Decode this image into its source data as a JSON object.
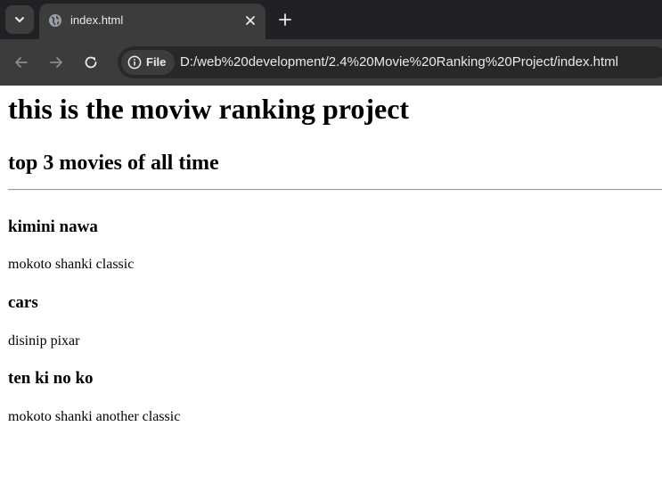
{
  "browser": {
    "tab": {
      "title": "index.html"
    },
    "address_bar": {
      "site_chip_label": "File",
      "url": "D:/web%20development/2.4%20Movie%20Ranking%20Project/index.html"
    },
    "colors": {
      "tabstrip_bg": "#202124",
      "toolbar_bg": "#3c3c3c",
      "omnibox_bg": "#282828",
      "text": "#e8eaed"
    },
    "icons": {
      "tab_search": "chevron-down-icon",
      "favicon": "globe-icon",
      "tab_close": "close-icon",
      "new_tab": "plus-icon",
      "back": "arrow-left-icon",
      "forward": "arrow-right-icon",
      "reload": "reload-icon",
      "site_info": "info-icon"
    }
  },
  "page": {
    "heading": "this is the moviw ranking project",
    "subheading": "top 3 movies of all time",
    "movies": [
      {
        "title": "kimini nawa",
        "description": "mokoto shanki classic"
      },
      {
        "title": "cars",
        "description": "disinip pixar"
      },
      {
        "title": "ten ki no ko",
        "description": "mokoto shanki another classic"
      }
    ]
  }
}
